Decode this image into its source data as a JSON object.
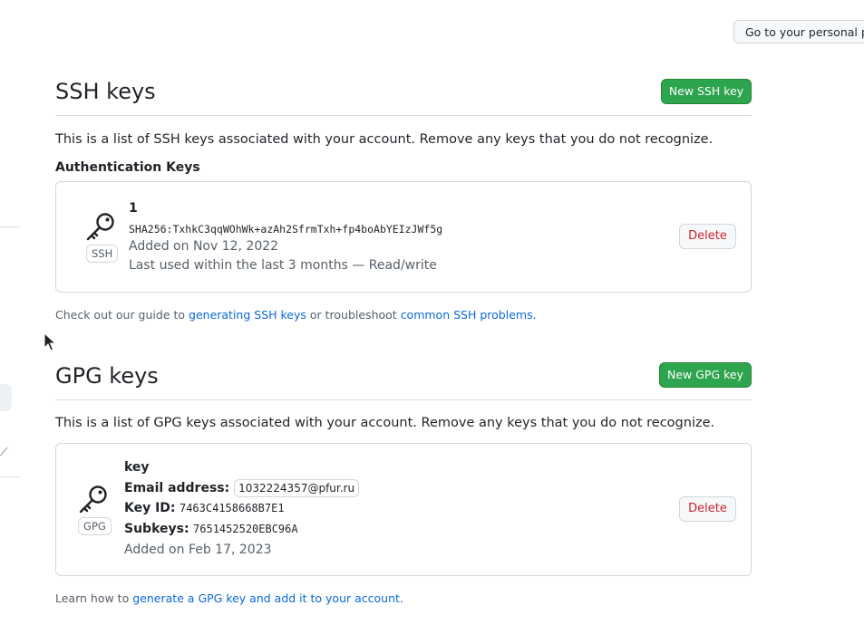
{
  "header": {
    "profile_button_label": "Go to your personal profile"
  },
  "ssh": {
    "title": "SSH keys",
    "new_button_label": "New SSH key",
    "description": "This is a list of SSH keys associated with your account. Remove any keys that you do not recognize.",
    "subheading": "Authentication Keys",
    "key": {
      "badge": "SSH",
      "name": "1",
      "fingerprint": "SHA256:TxhkC3qqWOhWk+azAh2SfrmTxh+fp4boAbYEIzJWf5g",
      "added": "Added on Nov 12, 2022",
      "last_used": "Last used within the last 3 months — Read/write",
      "delete_label": "Delete"
    },
    "footer": {
      "prefix": "Check out our guide to ",
      "link1": "generating SSH keys",
      "middle": " or troubleshoot ",
      "link2": "common SSH problems",
      "suffix": "."
    }
  },
  "gpg": {
    "title": "GPG keys",
    "new_button_label": "New GPG key",
    "description": "This is a list of GPG keys associated with your account. Remove any keys that you do not recognize.",
    "key": {
      "badge": "GPG",
      "name": "key",
      "email_label": "Email address:",
      "email": "1032224357@pfur.ru",
      "key_id_label": "Key ID:",
      "key_id": "7463C4158668B7E1",
      "subkeys_label": "Subkeys:",
      "subkeys": "7651452520EBC96A",
      "added": "Added on Feb 17, 2023",
      "delete_label": "Delete"
    },
    "footer": {
      "prefix": "Learn how to ",
      "link": "generate a GPG key and add it to your account",
      "suffix": "."
    }
  },
  "sidebar": {
    "partial_glyph": "⟋"
  },
  "colors": {
    "primary": "#2da44e",
    "danger": "#cf222e",
    "link": "#0969da",
    "border": "#d0d7de"
  }
}
